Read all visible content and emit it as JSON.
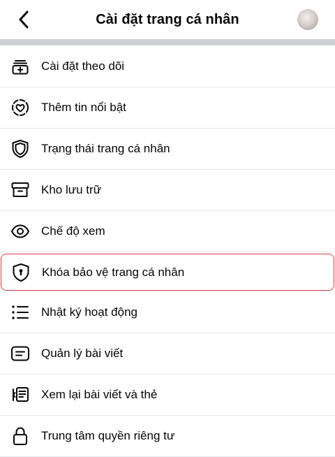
{
  "header": {
    "title": "Cài đặt trang cá nhân",
    "back_icon": "chevron-left-icon",
    "avatar": "avatar"
  },
  "menu": {
    "items": [
      {
        "label": "Cài đặt theo dõi",
        "icon": "add-follow-icon"
      },
      {
        "label": "Thêm tin nổi bật",
        "icon": "heart-circle-icon"
      },
      {
        "label": "Trạng thái trang cá nhân",
        "icon": "shield-icon"
      },
      {
        "label": "Kho lưu trữ",
        "icon": "archive-icon"
      },
      {
        "label": "Chế độ xem",
        "icon": "eye-icon"
      },
      {
        "label": "Khóa bảo vệ trang cá nhân",
        "icon": "shield-lock-icon",
        "highlighted": true
      },
      {
        "label": "Nhật ký hoạt động",
        "icon": "list-icon"
      },
      {
        "label": "Quản lý bài viết",
        "icon": "post-icon"
      },
      {
        "label": "Xem lại bài viết và thẻ",
        "icon": "review-posts-icon"
      },
      {
        "label": "Trung tâm quyền riêng tư",
        "icon": "lock-icon"
      }
    ]
  },
  "colors": {
    "highlight_border": "#e0393e",
    "separator_band": "#ced0d4",
    "row_divider": "#e4e6eb"
  }
}
